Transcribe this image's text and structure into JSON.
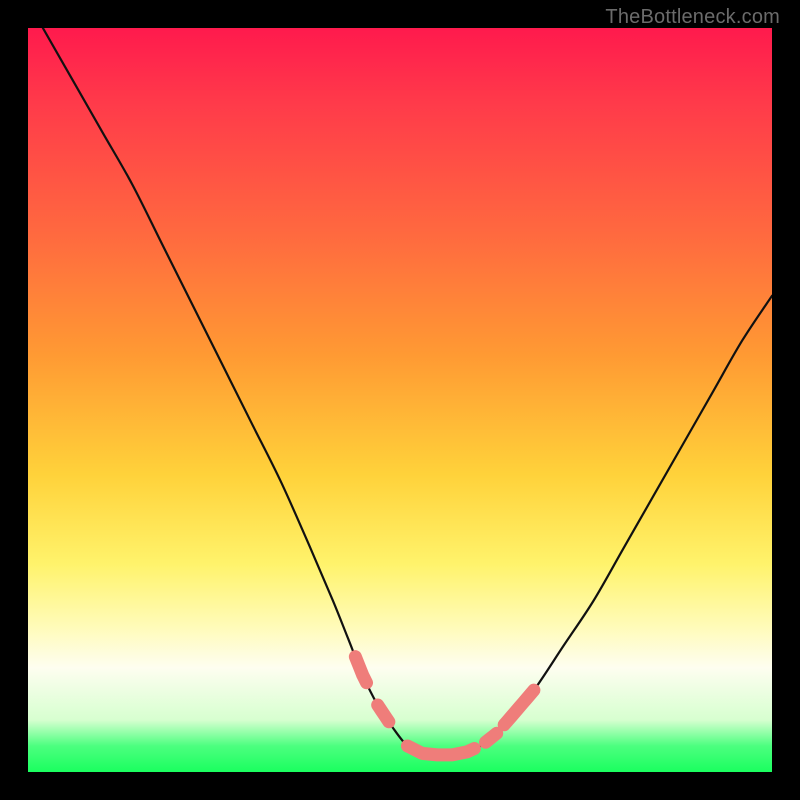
{
  "attribution": "TheBottleneck.com",
  "colors": {
    "frame": "#000000",
    "curve": "#111111",
    "accent_pink": "#ef7d7a",
    "gradient_top": "#ff1a4d",
    "gradient_bottom": "#1aff5f"
  },
  "chart_data": {
    "type": "line",
    "title": "",
    "xlabel": "",
    "ylabel": "",
    "xlim": [
      0,
      100
    ],
    "ylim": [
      0,
      100
    ],
    "note": "Values are the estimated visual curve height (0 = bottom green, 100 = top red) sampled along x. The curve has a V shape with a flat minimum around x≈52–60.",
    "x": [
      2,
      6,
      10,
      14,
      18,
      22,
      26,
      30,
      34,
      38,
      41,
      43,
      45,
      47,
      49,
      51,
      53,
      55,
      57,
      59,
      61,
      63,
      65,
      68,
      72,
      76,
      80,
      84,
      88,
      92,
      96,
      100
    ],
    "values": [
      100,
      93,
      86,
      79,
      71,
      63,
      55,
      47,
      39,
      30,
      23,
      18,
      13,
      9,
      6,
      3.5,
      2.5,
      2.3,
      2.3,
      2.7,
      3.6,
      5.2,
      7.5,
      11,
      17,
      23,
      30,
      37,
      44,
      51,
      58,
      64
    ],
    "accent_segments": [
      {
        "start_x": 44,
        "end_x": 45.5
      },
      {
        "start_x": 47,
        "end_x": 48.5
      },
      {
        "start_x": 51,
        "end_x": 60
      },
      {
        "start_x": 61.5,
        "end_x": 63
      },
      {
        "start_x": 64,
        "end_x": 68
      }
    ]
  }
}
